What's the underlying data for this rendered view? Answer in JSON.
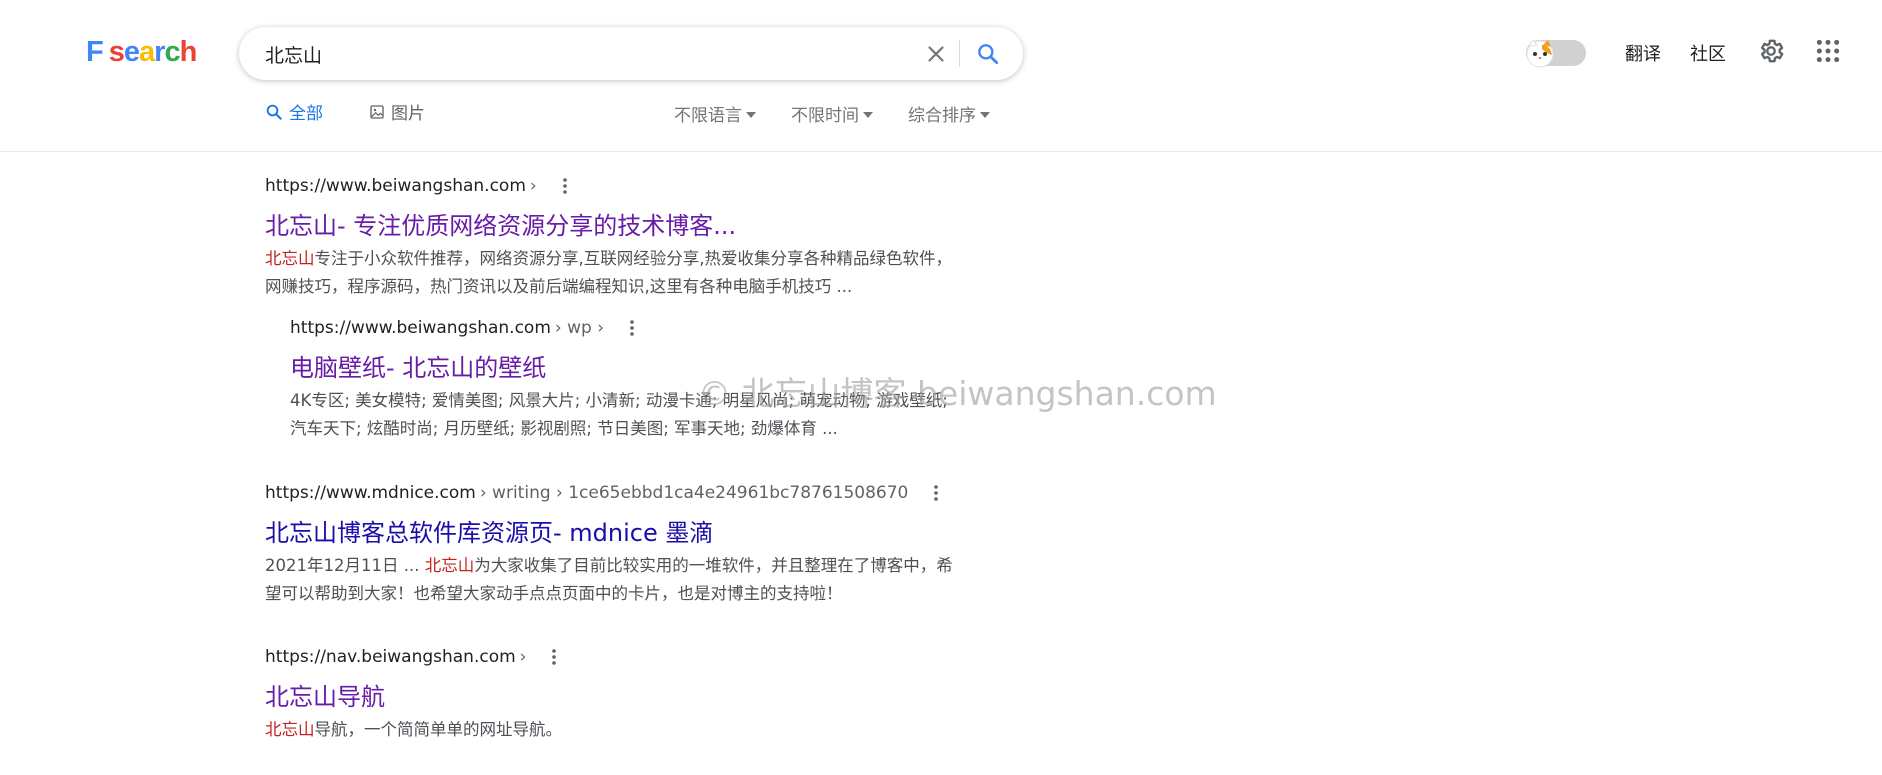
{
  "logo": {
    "letters": [
      "F",
      " ",
      "s",
      "e",
      "a",
      "r",
      "c",
      "h"
    ],
    "colors": [
      "#4285f4",
      "#ffffff",
      "#ea4335",
      "#4285f4",
      "#fbbc05",
      "#4285f4",
      "#34a853",
      "#ea4335"
    ]
  },
  "search": {
    "query": "北忘山",
    "clear_icon": "close-icon",
    "search_icon": "search-icon"
  },
  "tabs": [
    {
      "label": "全部",
      "icon": "search-icon",
      "active": true
    },
    {
      "label": "图片",
      "icon": "image-icon",
      "active": false
    }
  ],
  "filters": [
    {
      "label": "不限语言"
    },
    {
      "label": "不限时间"
    },
    {
      "label": "综合排序"
    }
  ],
  "header_right": {
    "toggle_icon": "cat-face-icon",
    "translate": "翻译",
    "community": "社区",
    "settings_icon": "gear-icon",
    "apps_icon": "apps-grid-icon"
  },
  "results": [
    {
      "url": "https://www.beiwangshan.com",
      "path": "›",
      "title": "北忘山- 专注优质网络资源分享的技术博客...",
      "visited": true,
      "snippet_highlight": "北忘山",
      "snippet_rest": "专注于小众软件推荐，网络资源分享,互联网经验分享,热爱收集分享各种精品绿色软件，网赚技巧，程序源码，热门资讯以及前后端编程知识,这里有各种电脑手机技巧 ..."
    },
    {
      "url": "https://www.beiwangshan.com",
      "path": "› wp ›",
      "title": "电脑壁纸- 北忘山的壁纸",
      "visited": true,
      "snippet_prefix": "",
      "snippet_highlight": "",
      "snippet_rest": "4K专区; 美女模特; 爱情美图; 风景大片; 小清新; 动漫卡通; 明星风尚; 萌宠动物; 游戏壁纸; 汽车天下; 炫酷时尚; 月历壁纸; 影视剧照; 节日美图; 军事天地; 劲爆体育 ..."
    },
    {
      "url": "https://www.mdnice.com",
      "path": "› writing › 1ce65ebbd1ca4e24961bc78761508670",
      "title": "北忘山博客总软件库资源页- mdnice 墨滴",
      "visited": false,
      "snippet_prefix": "2021年12月11日 ... ",
      "snippet_highlight": "北忘山",
      "snippet_rest": "为大家收集了目前比较实用的一堆软件，并且整理在了博客中，希望可以帮助到大家！也希望大家动手点点页面中的卡片，也是对博主的支持啦！"
    },
    {
      "url": "https://nav.beiwangshan.com",
      "path": "›",
      "title": "北忘山导航",
      "visited": true,
      "snippet_prefix": "",
      "snippet_highlight": "北忘山",
      "snippet_rest": "导航，一个简简单单的网址导航。"
    }
  ],
  "watermark": "© 北忘山博客 beiwangshan.com"
}
